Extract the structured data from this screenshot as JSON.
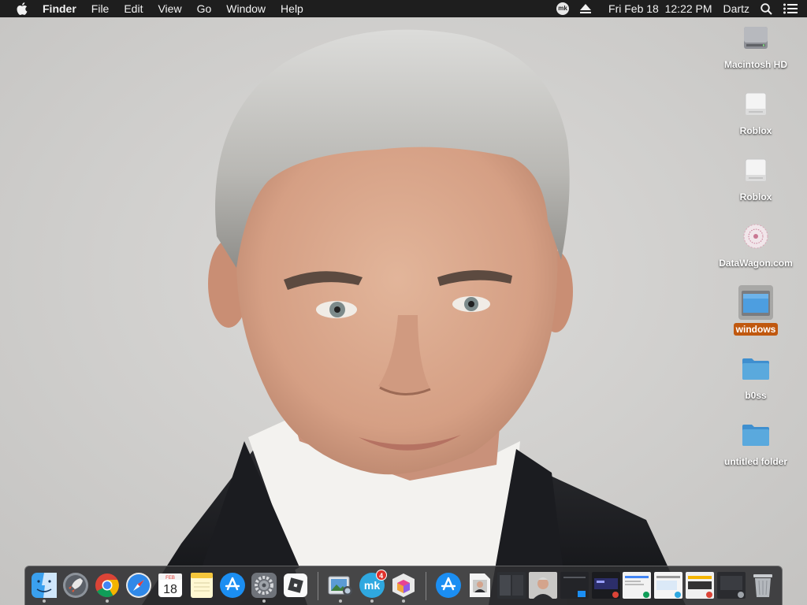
{
  "menubar": {
    "app_name": "Finder",
    "menus": [
      "File",
      "Edit",
      "View",
      "Go",
      "Window",
      "Help"
    ],
    "status": {
      "mk_label": "mk",
      "datetime": "Fri Feb 18  12:22 PM",
      "user": "Dartz"
    }
  },
  "desktop": {
    "icons": [
      {
        "label": "Macintosh HD",
        "icon": "hard-drive-icon"
      },
      {
        "label": "Roblox",
        "icon": "external-drive-icon"
      },
      {
        "label": "Roblox",
        "icon": "external-drive-icon"
      },
      {
        "label": "DataWagon.com",
        "icon": "network-volume-icon"
      },
      {
        "label": "windows",
        "icon": "disk-image-icon",
        "selected": true
      },
      {
        "label": "b0ss",
        "icon": "folder-icon"
      },
      {
        "label": "untitled folder",
        "icon": "folder-icon"
      }
    ]
  },
  "dock": {
    "calendar_month": "FEB",
    "calendar_day": "18",
    "mk_label": "mk",
    "mk_badge": "4",
    "colors": {
      "folder": "#5aa9dd",
      "accent_selected": "#c0580f",
      "badge": "#e0302a"
    }
  }
}
